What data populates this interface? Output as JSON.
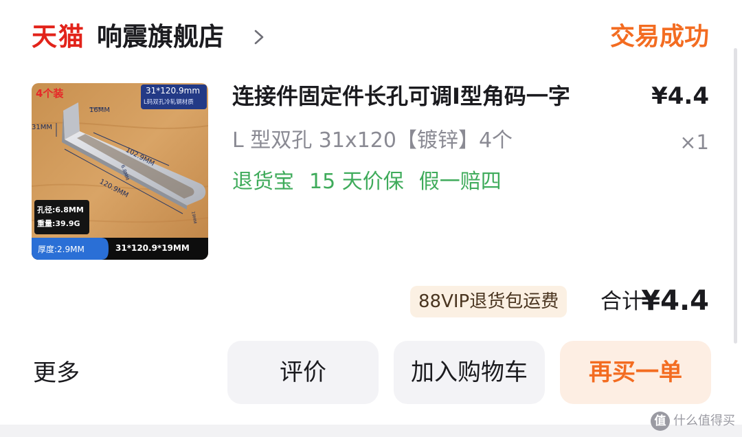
{
  "shop": {
    "platform_logo": "天猫",
    "name": "响震旗舰店",
    "status": "交易成功"
  },
  "product": {
    "title": "连接件固定件长孔可调I型角码一字",
    "price": "¥4.4",
    "spec": "L 型双孔 31x120【镀锌】4个",
    "quantity": "×1",
    "services": [
      "退货宝",
      "15 天价保",
      "假一赔四"
    ],
    "image": {
      "pack_badge": "4个装",
      "size_line": "31*120.9mm",
      "material_line": "L码双孔冷轧钢材质",
      "dim_16": "16MM",
      "dim_31": "31MM",
      "dim_102": "102.9MM",
      "dim_hole": "6.8MM",
      "dim_120": "120.9MM",
      "dim_19": "19MM",
      "hole_info": "孔径:6.8MM",
      "weight_info": "重量:39.9G",
      "thickness": "厚度:2.9MM",
      "dims_full": "31*120.9*19MM"
    }
  },
  "summary": {
    "vip_tag": "88VIP退货包运费",
    "total_label": "合计",
    "total_amount": "¥4.4"
  },
  "actions": {
    "more": "更多",
    "review": "评价",
    "add_to_cart": "加入购物车",
    "buy_again": "再买一单"
  },
  "watermark": {
    "icon_text": "值",
    "text": "什么值得买"
  },
  "colors": {
    "brand_red": "#e2231a",
    "accent_orange": "#f36c21",
    "service_green": "#3fab5b"
  }
}
